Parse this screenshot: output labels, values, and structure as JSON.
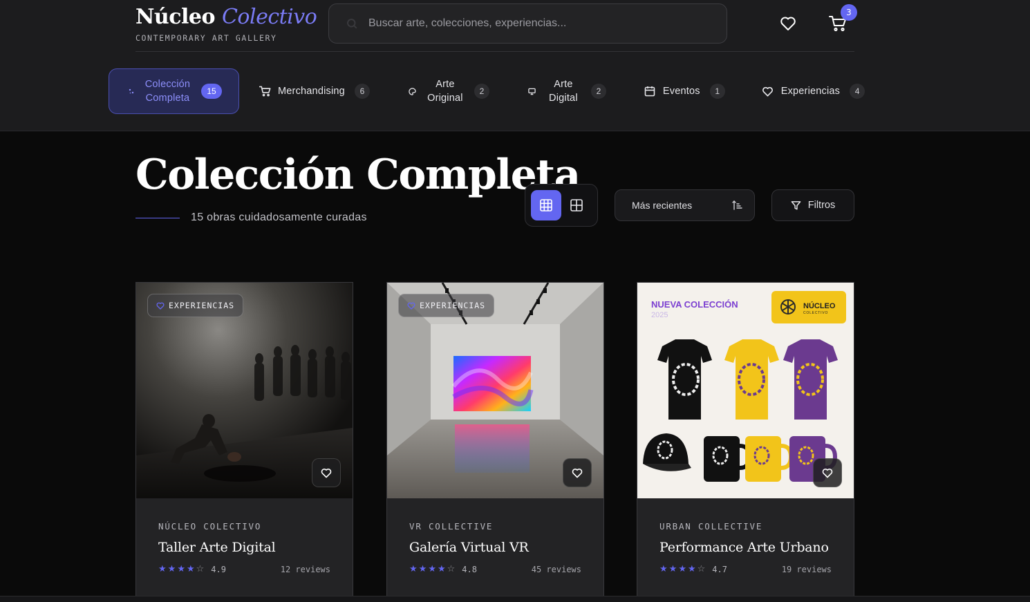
{
  "brand": {
    "name_main": "Núcleo",
    "name_accent": "Colectivo",
    "tagline": "CONTEMPORARY ART GALLERY"
  },
  "search": {
    "placeholder": "Buscar arte, colecciones, experiencias...",
    "value": "",
    "icon": "search-icon"
  },
  "header_actions": {
    "wishlist_icon": "heart-icon",
    "cart_icon": "cart-icon",
    "cart_count": "3"
  },
  "colors": {
    "accent": "#6366f1",
    "accent_light": "#7b7cf6",
    "background": "#0a0a0a",
    "header_bg": "#1c1c1e",
    "card_bg": "#232325"
  },
  "tabs": [
    {
      "label": "Colección Completa",
      "count": "15",
      "icon": "sparkle-icon",
      "active": true
    },
    {
      "label": "Merchandising",
      "count": "6",
      "icon": "cart-icon",
      "active": false
    },
    {
      "label": "Arte Original",
      "count": "2",
      "icon": "palette-icon",
      "active": false
    },
    {
      "label": "Arte Digital",
      "count": "2",
      "icon": "monitor-icon",
      "active": false
    },
    {
      "label": "Eventos",
      "count": "1",
      "icon": "calendar-icon",
      "active": false
    },
    {
      "label": "Experiencias",
      "count": "4",
      "icon": "heart-icon",
      "active": false
    }
  ],
  "page": {
    "title": "Colección Completa",
    "subtitle": "15 obras cuidadosamente curadas"
  },
  "view_toggle": {
    "active": "grid-3",
    "options": [
      "grid-3",
      "grid-2"
    ]
  },
  "sort": {
    "label": "Más recientes",
    "icon": "sort-ascending-icon"
  },
  "filters": {
    "label": "Filtros",
    "icon": "filter-icon"
  },
  "cards": [
    {
      "badge": "EXPERIENCIAS",
      "artist": "NÚCLEO COLECTIVO",
      "title": "Taller Arte Digital",
      "rating": "4.9",
      "stars_filled": 4,
      "reviews": "12 reviews",
      "image": "dark gallery performance"
    },
    {
      "badge": "EXPERIENCIAS",
      "artist": "VR COLLECTIVE",
      "title": "Galería Virtual VR",
      "rating": "4.8",
      "stars_filled": 4,
      "reviews": "45 reviews",
      "image": "white gallery with colorful screen"
    },
    {
      "badge": "",
      "artist": "URBAN COLLECTIVE",
      "title": "Performance Arte Urbano",
      "rating": "4.7",
      "stars_filled": 4,
      "reviews": "19 reviews",
      "image": "merchandise collection",
      "image_text": {
        "collection_label": "NUEVA COLECCIÓN",
        "year": "2025",
        "logo_main": "NÚCLEO",
        "logo_sub": "COLECTIVO"
      }
    }
  ]
}
